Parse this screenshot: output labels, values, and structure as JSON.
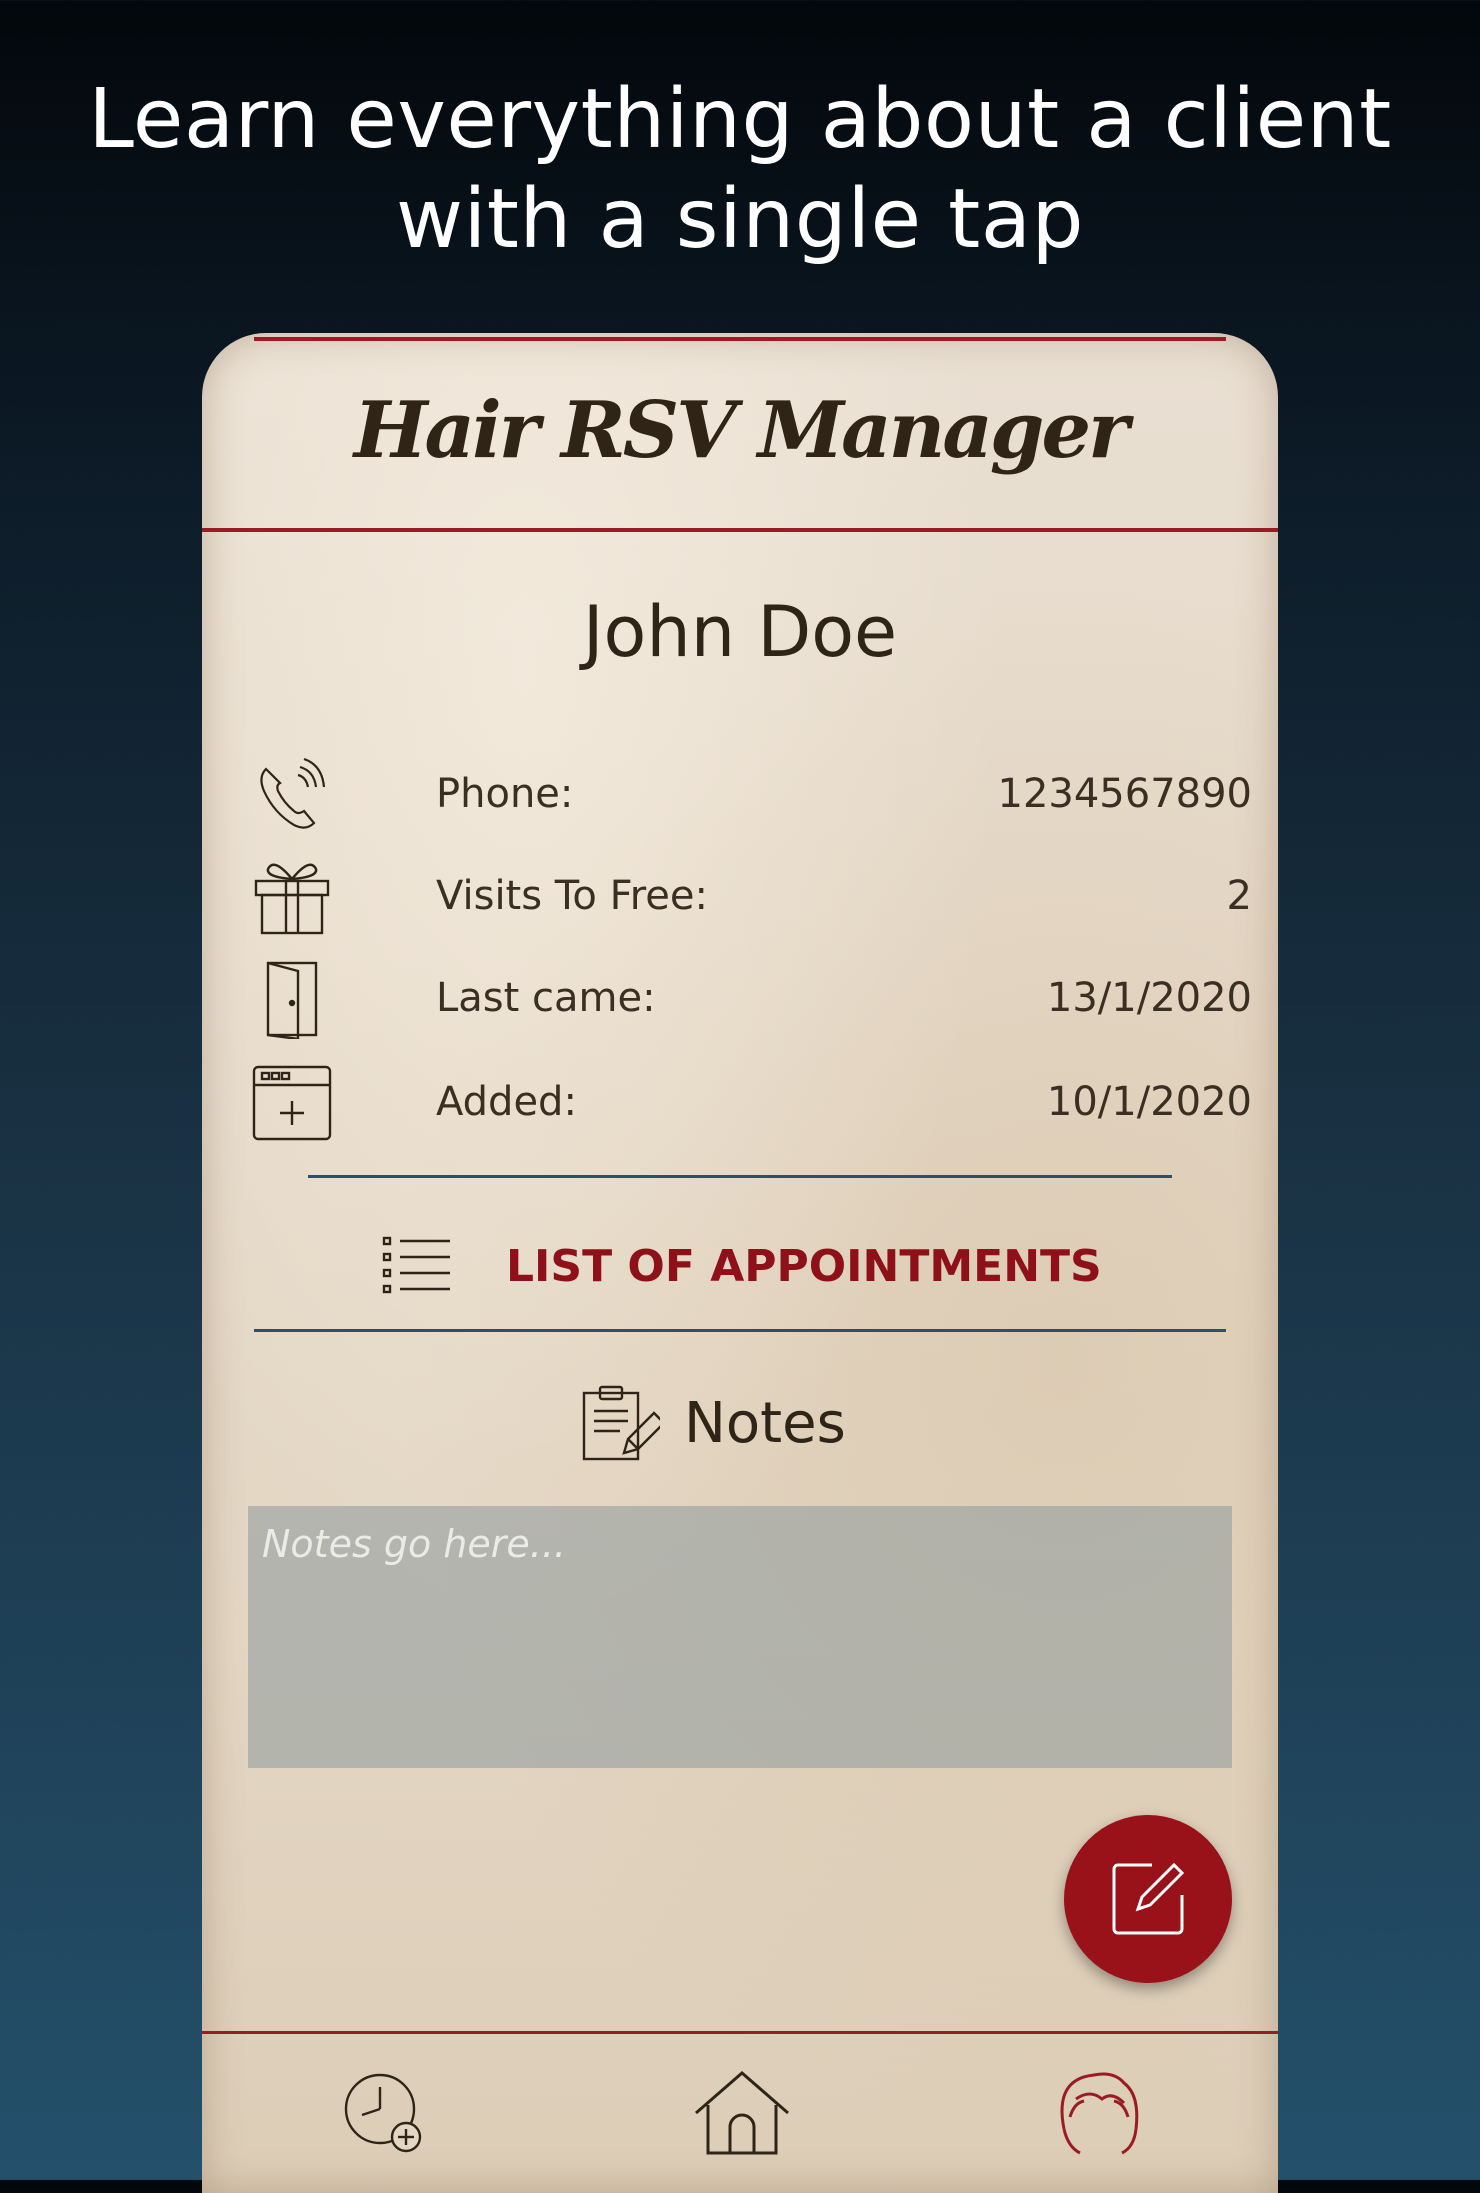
{
  "headline": {
    "line1": "Learn everything about a client",
    "line2": "with a single tap"
  },
  "app": {
    "title": "Hair RSV Manager",
    "accent_color": "#9b1b24"
  },
  "client": {
    "name": "John Doe",
    "fields": [
      {
        "icon": "phone-icon",
        "label": "Phone:",
        "value": "1234567890"
      },
      {
        "icon": "gift-icon",
        "label": "Visits To Free:",
        "value": "2"
      },
      {
        "icon": "door-icon",
        "label": "Last came:",
        "value": "13/1/2020"
      },
      {
        "icon": "calendar-add-icon",
        "label": "Added:",
        "value": "10/1/2020"
      }
    ]
  },
  "appointments_button": {
    "label": "LIST OF APPOINTMENTS",
    "icon": "list-icon"
  },
  "notes": {
    "heading": "Notes",
    "icon": "clipboard-edit-icon",
    "placeholder": "Notes go here...",
    "value": ""
  },
  "fab": {
    "icon": "edit-icon"
  },
  "bottom_nav": [
    {
      "icon": "clock-add-icon",
      "active": false
    },
    {
      "icon": "home-icon",
      "active": false
    },
    {
      "icon": "client-hair-icon",
      "active": true
    }
  ]
}
